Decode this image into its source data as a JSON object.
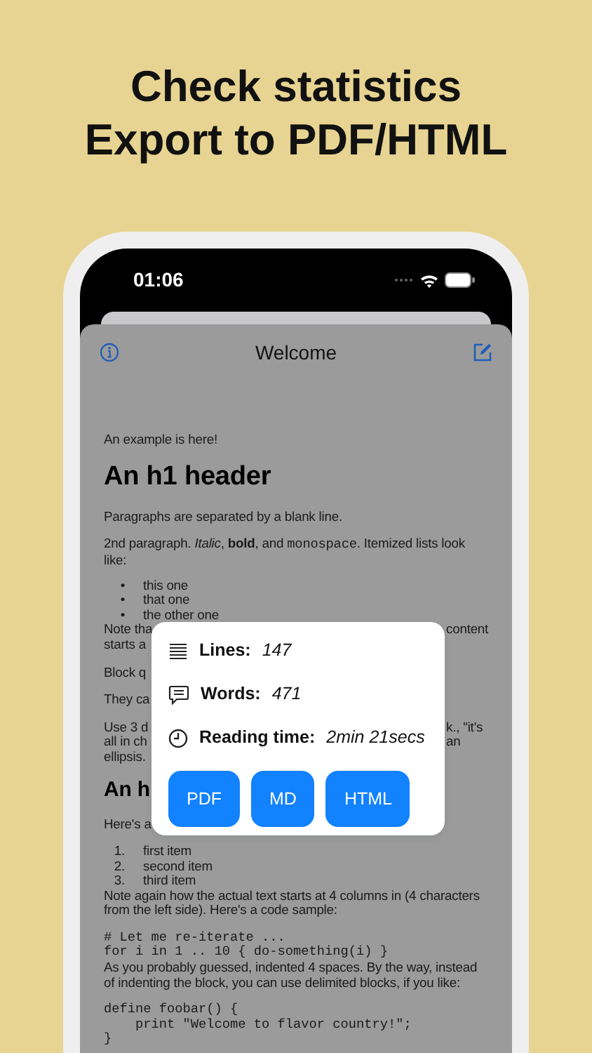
{
  "promo": {
    "headline": [
      "Check statistics",
      "Export to PDF/HTML"
    ]
  },
  "status_bar": {
    "time": "01:06"
  },
  "nav": {
    "title": "Welcome"
  },
  "document": [
    {
      "kind": "p",
      "segments": [
        {
          "kind": "plain",
          "text": "An example is here!"
        }
      ]
    },
    {
      "kind": "h1",
      "text": "An h1 header"
    },
    {
      "kind": "p",
      "segments": [
        {
          "kind": "plain",
          "text": "Paragraphs are separated by a blank line."
        }
      ]
    },
    {
      "kind": "p",
      "segments": [
        {
          "kind": "plain",
          "text": "2nd paragraph. "
        },
        {
          "kind": "italic",
          "text": "Italic"
        },
        {
          "kind": "plain",
          "text": ", "
        },
        {
          "kind": "bold",
          "text": "bold"
        },
        {
          "kind": "plain",
          "text": ", and "
        },
        {
          "kind": "code",
          "text": "monospace"
        },
        {
          "kind": "plain",
          "text": ". Itemized lists look like:"
        }
      ]
    },
    {
      "kind": "ul",
      "items": [
        {
          "marker": "•",
          "text": "this one"
        },
        {
          "marker": "•",
          "text": "that one"
        },
        {
          "marker": "•",
          "text": "the other one"
        }
      ]
    },
    {
      "kind": "split",
      "lines": [
        {
          "left": "Note tha",
          "right": "content"
        },
        {
          "left": "starts a"
        }
      ]
    },
    {
      "kind": "split",
      "lines": [
        {
          "left": "Block q"
        }
      ]
    },
    {
      "kind": "split",
      "lines": [
        {
          "left": "They ca"
        }
      ]
    },
    {
      "kind": "split",
      "lines": [
        {
          "left": "Use 3 d",
          "right": "k., \"it's"
        },
        {
          "left": "all in ch",
          "right": "an"
        },
        {
          "left": "ellipsis."
        }
      ]
    },
    {
      "kind": "h2",
      "text": "An h"
    },
    {
      "kind": "split",
      "lines": [
        {
          "left": "Here's a"
        }
      ]
    },
    {
      "kind": "ol",
      "items": [
        {
          "marker": "1.",
          "text": "first item"
        },
        {
          "marker": "2.",
          "text": "second item"
        },
        {
          "marker": "3.",
          "text": "third item"
        }
      ]
    },
    {
      "kind": "p",
      "segments": [
        {
          "kind": "plain",
          "text": "Note again how the actual text starts at 4 columns in (4 characters from the left side). Here's a code sample:"
        }
      ]
    },
    {
      "kind": "code",
      "lines": [
        "# Let me re-iterate ...",
        "for i in 1 .. 10 { do-something(i) }"
      ]
    },
    {
      "kind": "p",
      "segments": [
        {
          "kind": "plain",
          "text": "As you probably guessed, indented 4 spaces. By the way, instead of indenting the block, you can use delimited blocks, if you like:"
        }
      ]
    },
    {
      "kind": "code",
      "lines": [
        "define foobar() {",
        "    print \"Welcome to flavor country!\";",
        "}"
      ]
    }
  ],
  "stats_popup": {
    "rows": [
      {
        "kind": "lines",
        "label": "Lines:",
        "value": "147"
      },
      {
        "kind": "words",
        "label": "Words:",
        "value": "471"
      },
      {
        "kind": "time",
        "label": "Reading time:",
        "value": "2min 21secs"
      }
    ],
    "buttons": [
      "PDF",
      "MD",
      "HTML"
    ]
  }
}
